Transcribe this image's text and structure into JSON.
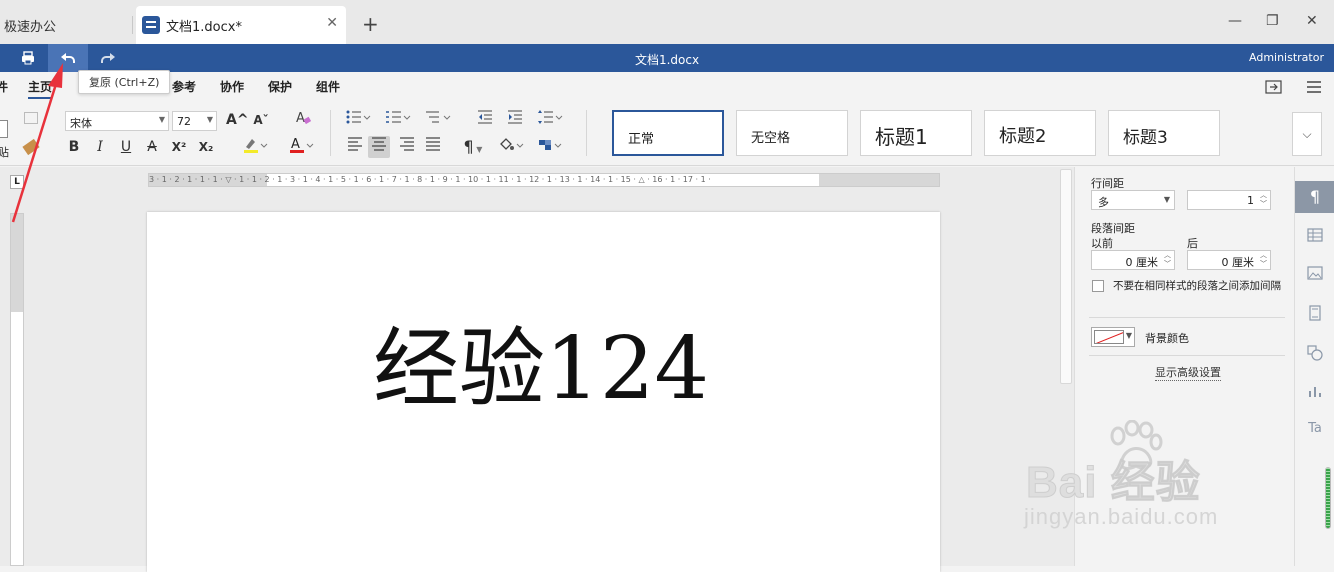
{
  "tabbar": {
    "app_tab": "极速办公",
    "doc_tab": "文档1.docx*",
    "new_tab": "+",
    "minimize": "—",
    "maximize": "❐",
    "close": "✕",
    "tab_close": "✕"
  },
  "titlebar": {
    "print_icon": "printer-icon",
    "undo_icon": "undo-icon",
    "redo_icon": "redo-icon",
    "title": "文档1.docx",
    "user": "Administrator"
  },
  "tooltip": {
    "text": "复原 (Ctrl+Z)"
  },
  "menu": {
    "partial_left": "件",
    "items": [
      "主页",
      "参考",
      "协作",
      "保护",
      "组件"
    ],
    "active": "主页"
  },
  "ribbon": {
    "paste_partial": "贴",
    "font_name": "宋体",
    "font_size": "72",
    "grow": "A^",
    "shrink": "Aˇ",
    "bold": "B",
    "italic": "I",
    "underline": "U",
    "strike": "A",
    "superscript": "X²",
    "subscript": "X₂",
    "pilcrow": "¶",
    "styles": [
      "正常",
      "无空格",
      "标题1",
      "标题2",
      "标题3"
    ],
    "active_style": "正常",
    "more": "⌵"
  },
  "ruler": {
    "corner": "L",
    "h_numbers": "3 · 1 · 2 · 1 · 1 · 1 · ▽ · 1 · 1 · 2 · 1 · 3 · 1 · 4 · 1 · 5 · 1 · 6 · 1 · 7 · 1 · 8 · 1 · 9 · 1 · 10 · 1 · 11 · 1 · 12 · 1 · 13 · 1 · 14 · 1 · 15 · △ · 16 · 1 · 17 · 1 ·"
  },
  "document": {
    "text": "经验124"
  },
  "panel": {
    "line_spacing_label": "行间距",
    "line_spacing_mode": "多",
    "line_spacing_value": "1",
    "para_spacing_label": "段落间距",
    "before_label": "以前",
    "after_label": "后",
    "before_value": "0 厘米",
    "after_value": "0 厘米",
    "no_space_label": "不要在相同样式的段落之间添加间隔",
    "bg_color_label": "背景颜色",
    "advanced_link": "显示高级设置"
  },
  "sidebar": {
    "icons": [
      "paragraph-icon",
      "table-icon",
      "image-icon",
      "header-footer-icon",
      "shape-icon",
      "chart-icon",
      "text-art-icon"
    ],
    "active": "paragraph-icon"
  },
  "watermark": {
    "main": "Bai 经验",
    "sub": "jingyan.baidu.com"
  }
}
